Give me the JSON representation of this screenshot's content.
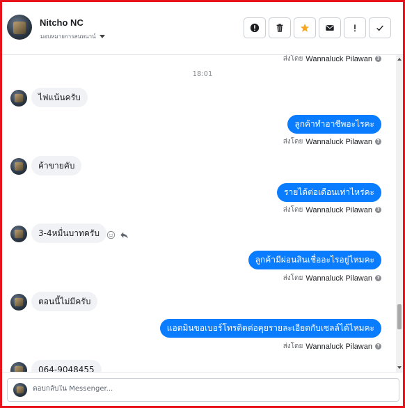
{
  "header": {
    "contact_name": "Nitcho NC",
    "assign_label": "มอบหมายการสนทนาน์",
    "actions": [
      {
        "name": "report-button",
        "icon": "exclamation-circle-icon",
        "label": "!"
      },
      {
        "name": "delete-button",
        "icon": "trash-icon"
      },
      {
        "name": "star-button",
        "icon": "star-icon",
        "color": "#f5a623"
      },
      {
        "name": "mark-unread-button",
        "icon": "envelope-icon"
      },
      {
        "name": "follow-up-button",
        "icon": "exclamation-icon",
        "label": "!"
      },
      {
        "name": "done-button",
        "icon": "checkmark-icon"
      }
    ]
  },
  "chat": {
    "sent_by_prefix": "ส่งโดย",
    "sent_by_name": "Wannaluck Pilawan",
    "time_divider": "18:01",
    "messages": [
      {
        "direction": "in",
        "text": "ไฟแน้นครับ"
      },
      {
        "direction": "out",
        "text": "ลูกค้าทำอาชีพอะไรคะ"
      },
      {
        "direction": "in",
        "text": "ค้าขายคับ"
      },
      {
        "direction": "out",
        "text": "รายได้ต่อเดือนเท่าไหร่คะ"
      },
      {
        "direction": "in",
        "text": "3-4หมื่นบาทครับ"
      },
      {
        "direction": "out",
        "text": "ลูกค้ามีผ่อนสินเชื่ออะไรอยู่ไหมคะ"
      },
      {
        "direction": "in",
        "text": "ตอนนี้ไม่มีครับ"
      },
      {
        "direction": "out",
        "text": "แอดมินขอเบอร์โทรติดต่อคุยรายละเอียดกับเซลล์ได้ไหมคะ"
      },
      {
        "direction": "in",
        "text": "064-9048455"
      }
    ]
  },
  "composer": {
    "placeholder": "ตอบกลับใน Messenger..."
  },
  "colors": {
    "outgoing_bubble": "#0a7cff",
    "incoming_bubble": "#f0f2f5",
    "frame_border": "#e8121a"
  }
}
